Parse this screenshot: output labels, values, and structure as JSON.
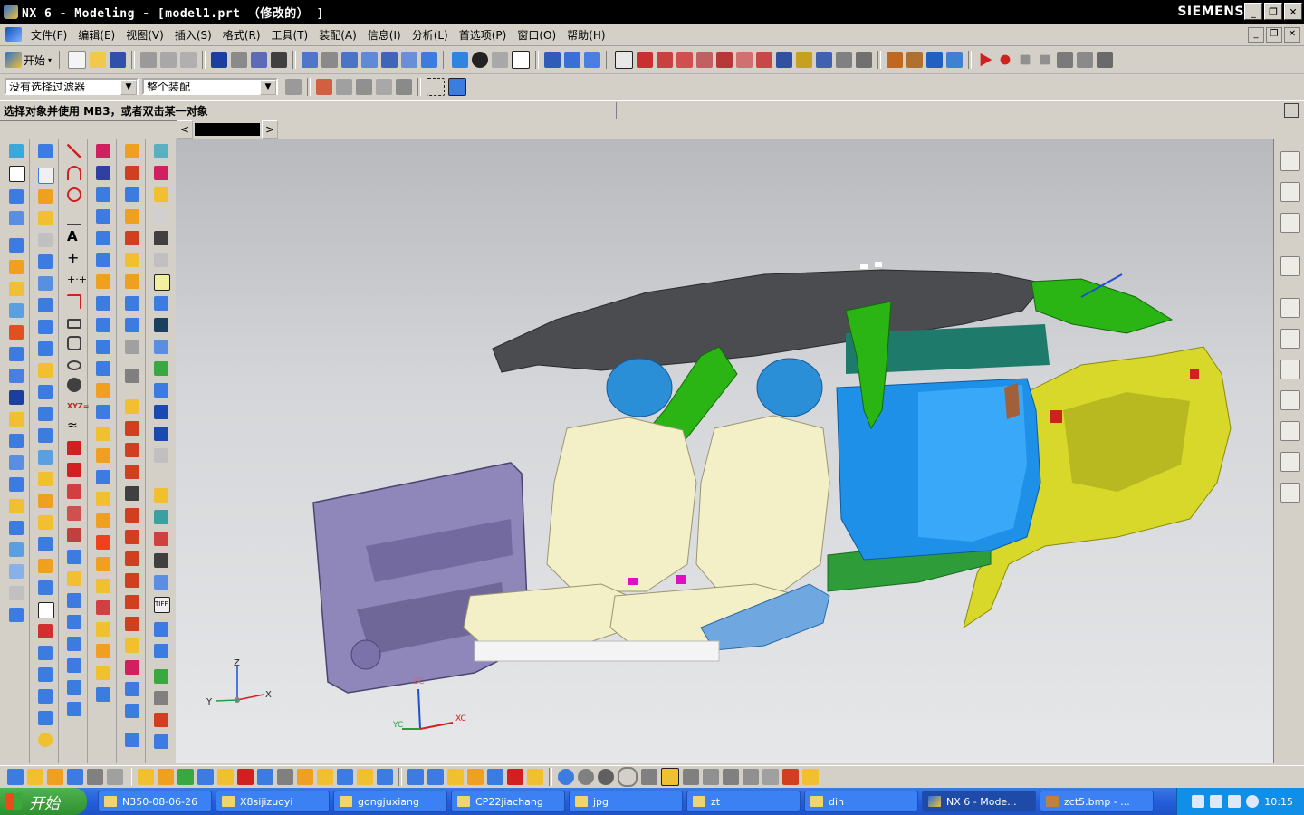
{
  "window": {
    "title": "NX 6 - Modeling - [model1.prt （修改的） ]",
    "brand": "SIEMENS",
    "controls": [
      "_",
      "❐",
      "✕"
    ]
  },
  "menu": {
    "items": [
      "文件(F)",
      "编辑(E)",
      "视图(V)",
      "插入(S)",
      "格式(R)",
      "工具(T)",
      "装配(A)",
      "信息(I)",
      "分析(L)",
      "首选项(P)",
      "窗口(O)",
      "帮助(H)"
    ],
    "mdi_controls": [
      "_",
      "❐",
      "✕"
    ]
  },
  "toolbar": {
    "start_label": "开始",
    "filter_value": "没有选择过滤器",
    "scope_value": "整个装配"
  },
  "cue": {
    "text": "选择对象并使用 MB3，或者双击某一对象"
  },
  "tabs": {
    "prev": "<",
    "next": ">"
  },
  "triad": {
    "z": "Z",
    "y": "Y",
    "x": "X",
    "zc": "ZC",
    "yc": "YC",
    "xc": "XC"
  },
  "colors": {
    "headliner": "#4a4c50",
    "seat": "#f3f0c7",
    "headrest": "#2b8fd8",
    "pillar": "#2ab515",
    "door_panel": "#8f87ba",
    "rear_seat": "#1e90e8",
    "quarter_trim": "#d8d82a",
    "console": "#2e9d39"
  },
  "taskbar": {
    "start": "开始",
    "tasks": [
      {
        "label": "N350-08-06-26",
        "icon": "folder-icon"
      },
      {
        "label": "X8sijizuoyi",
        "icon": "folder-icon"
      },
      {
        "label": "gongjuxiang",
        "icon": "folder-icon"
      },
      {
        "label": "CP22jiachang",
        "icon": "folder-icon"
      },
      {
        "label": "jpg",
        "icon": "folder-icon"
      },
      {
        "label": "zt",
        "icon": "folder-icon"
      },
      {
        "label": "din",
        "icon": "folder-icon"
      },
      {
        "label": "NX 6 - Mode...",
        "icon": "nx-icon"
      },
      {
        "label": "zct5.bmp - ...",
        "icon": "bmp-icon"
      }
    ],
    "clock": "10:15"
  }
}
